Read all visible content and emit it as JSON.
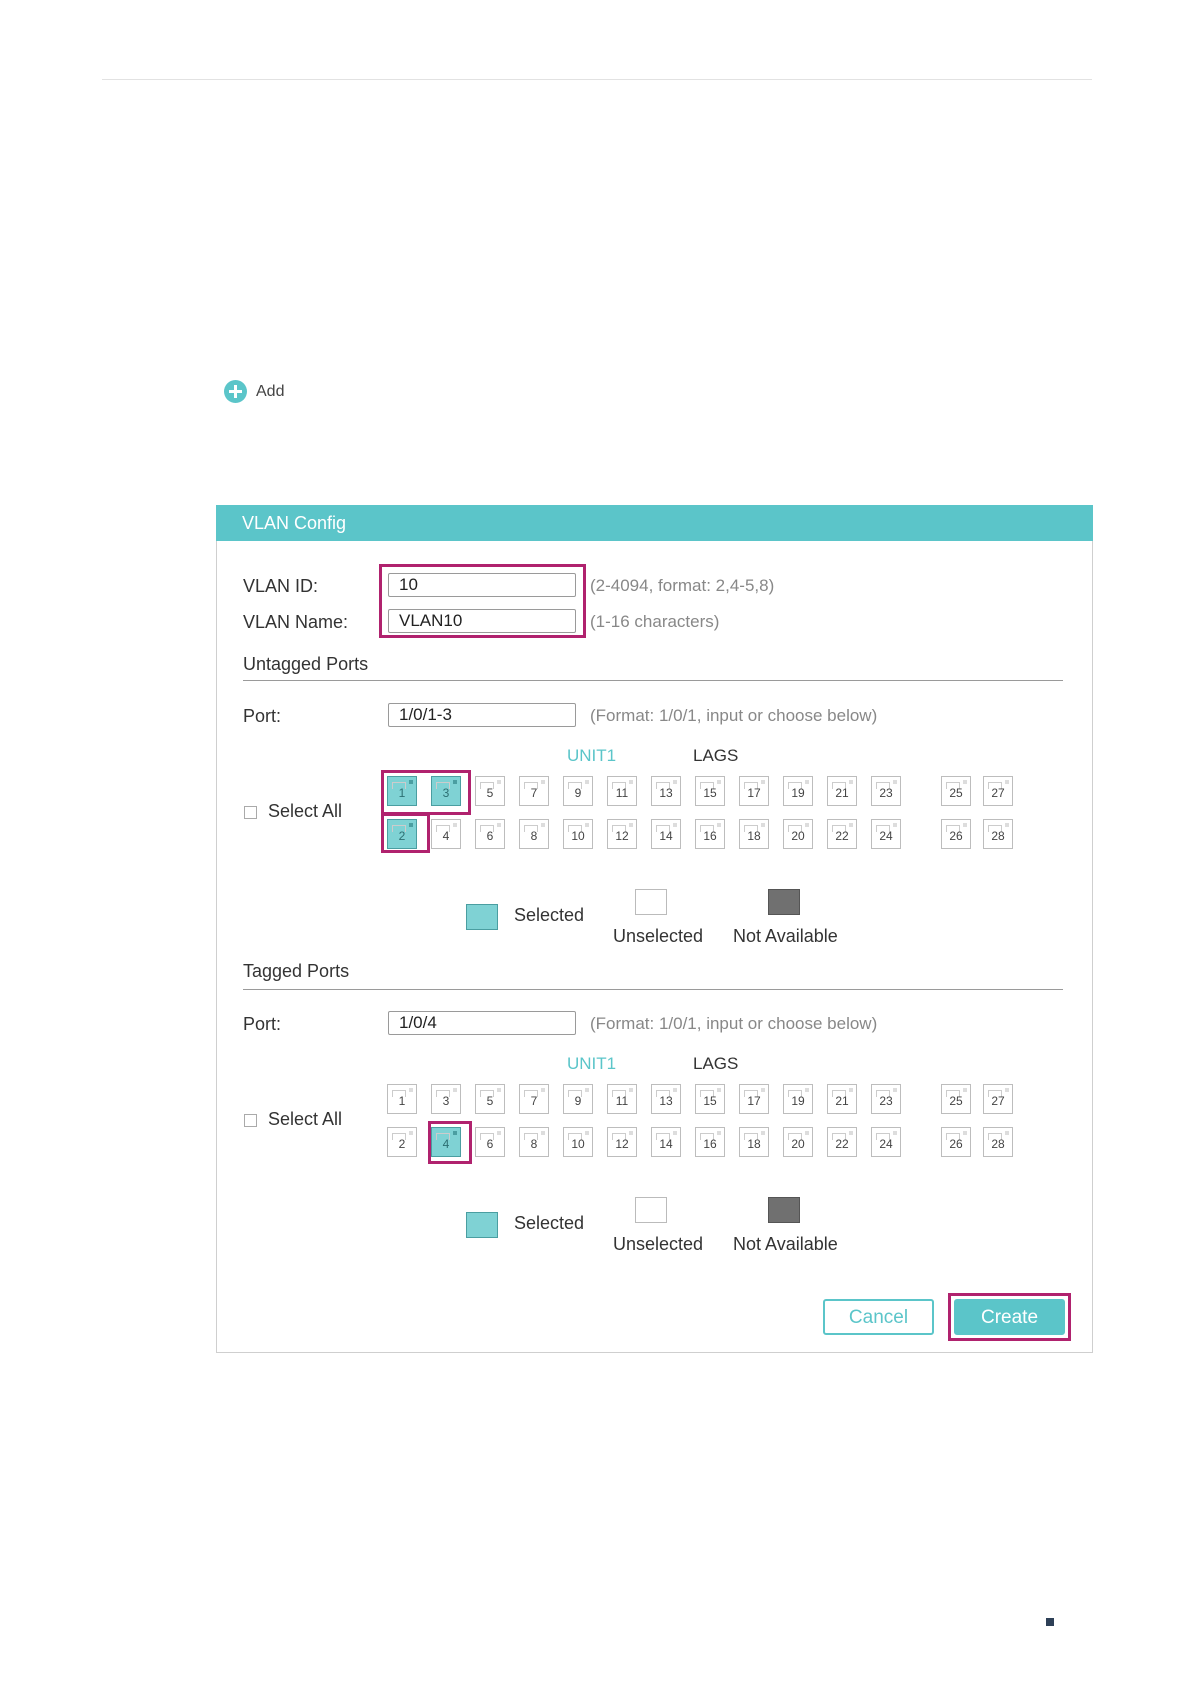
{
  "toolbar": {
    "add_label": "Add"
  },
  "panel": {
    "title": "VLAN Config"
  },
  "vlan_id": {
    "label": "VLAN ID:",
    "value": "10",
    "hint": "(2-4094, format: 2,4-5,8)"
  },
  "vlan_name": {
    "label": "VLAN Name:",
    "value": "VLAN10",
    "hint": "(1-16 characters)"
  },
  "untagged": {
    "section_title": "Untagged Ports",
    "port_label": "Port:",
    "port_value": "1/0/1-3",
    "port_hint": "(Format: 1/0/1, input or choose below)",
    "unit_label": "UNIT1",
    "lags_label": "LAGS",
    "select_all": "Select All",
    "selected_ports": [
      "1",
      "2",
      "3"
    ]
  },
  "tagged": {
    "section_title": "Tagged Ports",
    "port_label": "Port:",
    "port_value": "1/0/4",
    "port_hint": "(Format: 1/0/1, input or choose below)",
    "unit_label": "UNIT1",
    "lags_label": "LAGS",
    "select_all": "Select All",
    "selected_ports": [
      "4"
    ]
  },
  "ports": {
    "top_row": [
      "1",
      "3",
      "5",
      "7",
      "9",
      "11",
      "13",
      "15",
      "17",
      "19",
      "21",
      "23"
    ],
    "bottom_row": [
      "2",
      "4",
      "6",
      "8",
      "10",
      "12",
      "14",
      "16",
      "18",
      "20",
      "22",
      "24"
    ],
    "lag_top": [
      "25",
      "27"
    ],
    "lag_bottom": [
      "26",
      "28"
    ]
  },
  "legend": {
    "selected": "Selected",
    "unselected": "Unselected",
    "not_available": "Not Available"
  },
  "buttons": {
    "cancel": "Cancel",
    "create": "Create"
  },
  "colors": {
    "accent": "#5bc5c9",
    "highlight": "#b0226e",
    "selected_port": "#7fd2d4",
    "not_available": "#707070"
  }
}
